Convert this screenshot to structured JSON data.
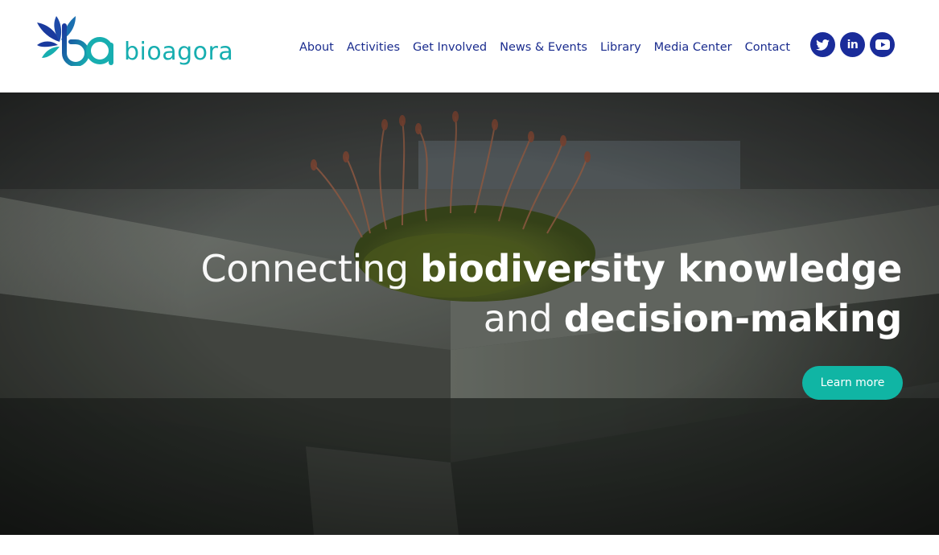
{
  "brand": {
    "name": "bioagora",
    "logo_icon": "leaf-ba-monogram-icon",
    "colors": {
      "primary": "#1a2c9a",
      "teal": "#17aeb0",
      "nav_text": "#1a2c8e",
      "cta": "#10b5a4"
    }
  },
  "nav": {
    "items": [
      {
        "label": "About"
      },
      {
        "label": "Activities"
      },
      {
        "label": "Get Involved"
      },
      {
        "label": "News & Events"
      },
      {
        "label": "Library"
      },
      {
        "label": "Media Center"
      },
      {
        "label": "Contact"
      }
    ]
  },
  "social": {
    "items": [
      {
        "icon": "twitter-icon"
      },
      {
        "icon": "linkedin-icon",
        "glyph": "in"
      },
      {
        "icon": "youtube-icon"
      }
    ]
  },
  "hero": {
    "line1_light": "Connecting ",
    "line1_bold": "biodiversity knowledge",
    "line2_light": "and ",
    "line2_bold": "decision-making",
    "cta_label": "Learn more",
    "background": "moss-on-weathered-wood-photo"
  }
}
